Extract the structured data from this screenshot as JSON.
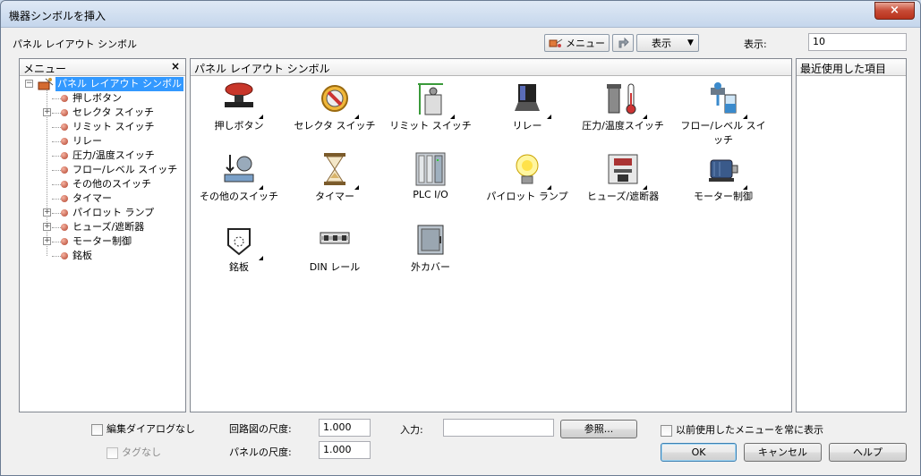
{
  "window": {
    "title": "機器シンボルを挿入",
    "close": "×"
  },
  "toolbar": {
    "section_label": "パネル レイアウト シンボル",
    "menu_button": "メニュー",
    "view_button": "表示",
    "display_label": "表示:",
    "display_value": "10"
  },
  "menu_panel": {
    "header": "メニュー",
    "close": "×",
    "root": "パネル レイアウト シンボル",
    "items": [
      {
        "label": "押しボタン",
        "expandable": false
      },
      {
        "label": "セレクタ スイッチ",
        "expandable": true
      },
      {
        "label": "リミット スイッチ",
        "expandable": false
      },
      {
        "label": "リレー",
        "expandable": false
      },
      {
        "label": "圧力/温度スイッチ",
        "expandable": false
      },
      {
        "label": "フロー/レベル スイッチ",
        "expandable": false
      },
      {
        "label": "その他のスイッチ",
        "expandable": false
      },
      {
        "label": "タイマー",
        "expandable": false
      },
      {
        "label": "パイロット ランプ",
        "expandable": true
      },
      {
        "label": "ヒューズ/遮断器",
        "expandable": true
      },
      {
        "label": "モーター制御",
        "expandable": true
      },
      {
        "label": "銘板",
        "expandable": false
      }
    ]
  },
  "symbols_panel": {
    "header": "パネル レイアウト シンボル",
    "symbols": [
      {
        "label": "押しボタン",
        "icon": "pushbutton-icon",
        "submenu": true
      },
      {
        "label": "セレクタ スイッチ",
        "icon": "selector-switch-icon",
        "submenu": true
      },
      {
        "label": "リミット スイッチ",
        "icon": "limit-switch-icon",
        "submenu": true
      },
      {
        "label": "リレー",
        "icon": "relay-icon",
        "submenu": true
      },
      {
        "label": "圧力/温度スイッチ",
        "icon": "pressure-temperature-icon",
        "submenu": true
      },
      {
        "label": "フロー/レベル スイッチ",
        "icon": "flow-level-icon",
        "submenu": true
      },
      {
        "label": "その他のスイッチ",
        "icon": "other-switch-icon",
        "submenu": true
      },
      {
        "label": "タイマー",
        "icon": "timer-icon",
        "submenu": true
      },
      {
        "label": "PLC I/O",
        "icon": "plc-io-icon",
        "submenu": false
      },
      {
        "label": "パイロット ランプ",
        "icon": "pilot-lamp-icon",
        "submenu": true
      },
      {
        "label": "ヒューズ/遮断器",
        "icon": "fuse-breaker-icon",
        "submenu": true
      },
      {
        "label": "モーター制御",
        "icon": "motor-control-icon",
        "submenu": true
      },
      {
        "label": "銘板",
        "icon": "nameplate-icon",
        "submenu": true
      },
      {
        "label": "DIN レール",
        "icon": "din-rail-icon",
        "submenu": false
      },
      {
        "label": "外カバー",
        "icon": "enclosure-icon",
        "submenu": false
      }
    ]
  },
  "recent_panel": {
    "header": "最近使用した項目"
  },
  "footer": {
    "no_edit_dialog": "編集ダイアログなし",
    "no_tag": "タグなし",
    "schematic_scale_label": "回路図の尺度:",
    "schematic_scale_value": "1.000",
    "panel_scale_label": "パネルの尺度:",
    "panel_scale_value": "1.000",
    "input_label": "入力:",
    "input_value": "",
    "browse_button": "参照...",
    "always_show_prev_menu": "以前使用したメニューを常に表示",
    "ok_button": "OK",
    "cancel_button": "キャンセル",
    "help_button": "ヘルプ"
  }
}
